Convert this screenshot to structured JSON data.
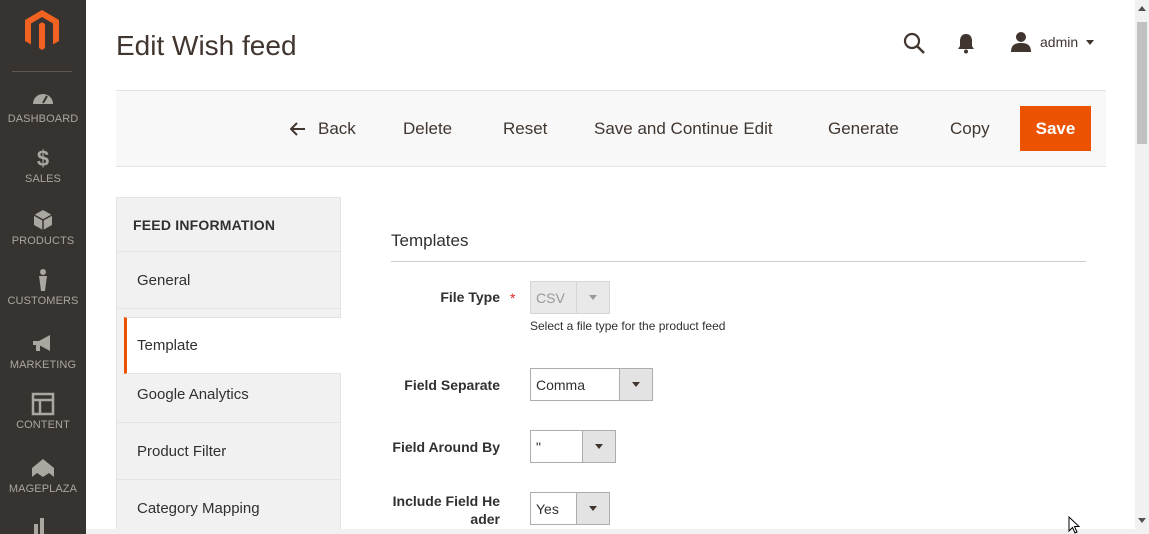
{
  "sidebar": {
    "items": [
      {
        "label": "DASHBOARD",
        "icon": "dashboard-icon"
      },
      {
        "label": "SALES",
        "icon": "dollar-icon"
      },
      {
        "label": "PRODUCTS",
        "icon": "cube-icon"
      },
      {
        "label": "CUSTOMERS",
        "icon": "person-icon"
      },
      {
        "label": "MARKETING",
        "icon": "megaphone-icon"
      },
      {
        "label": "CONTENT",
        "icon": "layout-icon"
      },
      {
        "label": "MAGEPLAZA",
        "icon": "mageplaza-icon"
      }
    ]
  },
  "header": {
    "title": "Edit Wish feed",
    "user": "admin"
  },
  "actions": {
    "back": "Back",
    "delete": "Delete",
    "reset": "Reset",
    "save_continue": "Save and Continue Edit",
    "generate": "Generate",
    "copy": "Copy",
    "save": "Save"
  },
  "tabs": {
    "title": "FEED INFORMATION",
    "items": [
      "General",
      "Template",
      "Google Analytics",
      "Product Filter",
      "Category Mapping"
    ],
    "active": "Template"
  },
  "form": {
    "section_title": "Templates",
    "file_type": {
      "label": "File Type",
      "required_mark": "*",
      "value": "CSV",
      "note": "Select a file type for the product feed"
    },
    "field_separate": {
      "label": "Field Separate",
      "value": "Comma"
    },
    "field_around_by": {
      "label": "Field Around By",
      "value": "\""
    },
    "include_field_header": {
      "label_line1": "Include Field He",
      "label_line2": "ader",
      "value": "Yes"
    }
  },
  "colors": {
    "sidebar_bg": "#373330",
    "accent": "#eb5202",
    "logo": "#f26322"
  }
}
